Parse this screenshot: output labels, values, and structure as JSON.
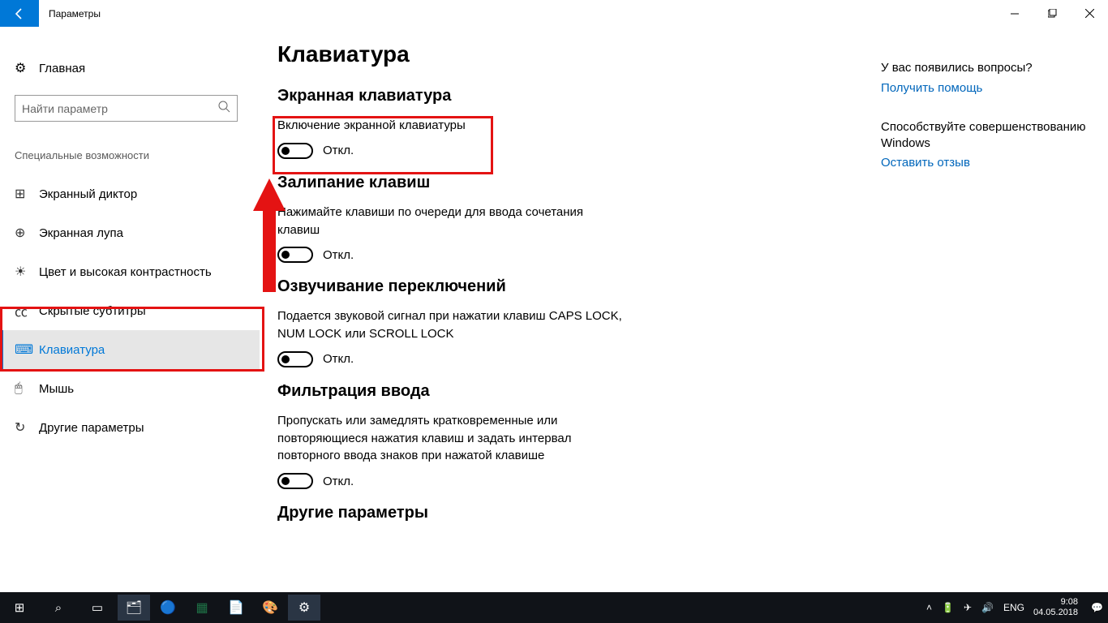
{
  "titlebar": {
    "title": "Параметры"
  },
  "sidebar": {
    "home": "Главная",
    "search_placeholder": "Найти параметр",
    "nav_title": "Специальные возможности",
    "items": [
      {
        "label": "Экранный диктор"
      },
      {
        "label": "Экранная лупа"
      },
      {
        "label": "Цвет и высокая контрастность"
      },
      {
        "label": "Скрытые субтитры"
      },
      {
        "label": "Клавиатура"
      },
      {
        "label": "Мышь"
      },
      {
        "label": "Другие параметры"
      }
    ]
  },
  "main": {
    "page_title": "Клавиатура",
    "sections": [
      {
        "heading": "Экранная клавиатура",
        "label": "Включение экранной клавиатуры",
        "state": "Откл."
      },
      {
        "heading": "Залипание клавиш",
        "label": "Нажимайте клавиши по очереди для ввода сочетания клавиш",
        "state": "Откл."
      },
      {
        "heading": "Озвучивание переключений",
        "label": "Подается звуковой сигнал при нажатии клавиш CAPS LOCK, NUM LOCK или SCROLL LOCK",
        "state": "Откл."
      },
      {
        "heading": "Фильтрация ввода",
        "label": "Пропускать или замедлять кратковременные или повторяющиеся нажатия клавиш и задать интервал повторного ввода знаков при нажатой клавише",
        "state": "Откл."
      },
      {
        "heading": "Другие параметры",
        "label": "",
        "state": ""
      }
    ]
  },
  "help": {
    "q": "У вас появились вопросы?",
    "get_help": "Получить помощь",
    "improve1": "Способствуйте совершенствованию Windows",
    "feedback": "Оставить отзыв"
  },
  "taskbar": {
    "lang": "ENG",
    "time": "9:08",
    "date": "04.05.2018"
  }
}
